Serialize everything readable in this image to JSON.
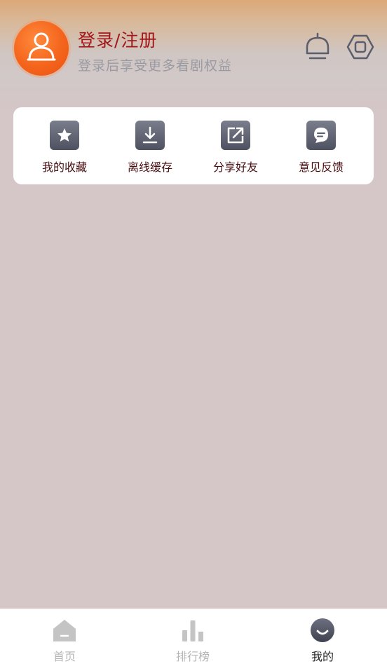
{
  "header": {
    "login_title": "登录/注册",
    "login_subtitle": "登录后享受更多看剧权益",
    "icons": [
      "avatar-person-icon",
      "bell-icon",
      "settings-hexagon-icon"
    ]
  },
  "quick_actions": [
    {
      "label": "我的收藏",
      "icon": "star-icon"
    },
    {
      "label": "离线缓存",
      "icon": "download-icon"
    },
    {
      "label": "分享好友",
      "icon": "share-icon"
    },
    {
      "label": "意见反馈",
      "icon": "feedback-chat-icon"
    }
  ],
  "tabbar": {
    "tabs": [
      {
        "label": "首页",
        "icon": "home-icon",
        "active": false
      },
      {
        "label": "排行榜",
        "icon": "bar-chart-icon",
        "active": false
      },
      {
        "label": "我的",
        "icon": "smile-face-icon",
        "active": true
      }
    ]
  },
  "colors": {
    "accent_red": "#a3161a",
    "avatar_orange": "#f4641c",
    "page_background": "#d5c6c7",
    "icon_gray": "#5a5e6c"
  }
}
